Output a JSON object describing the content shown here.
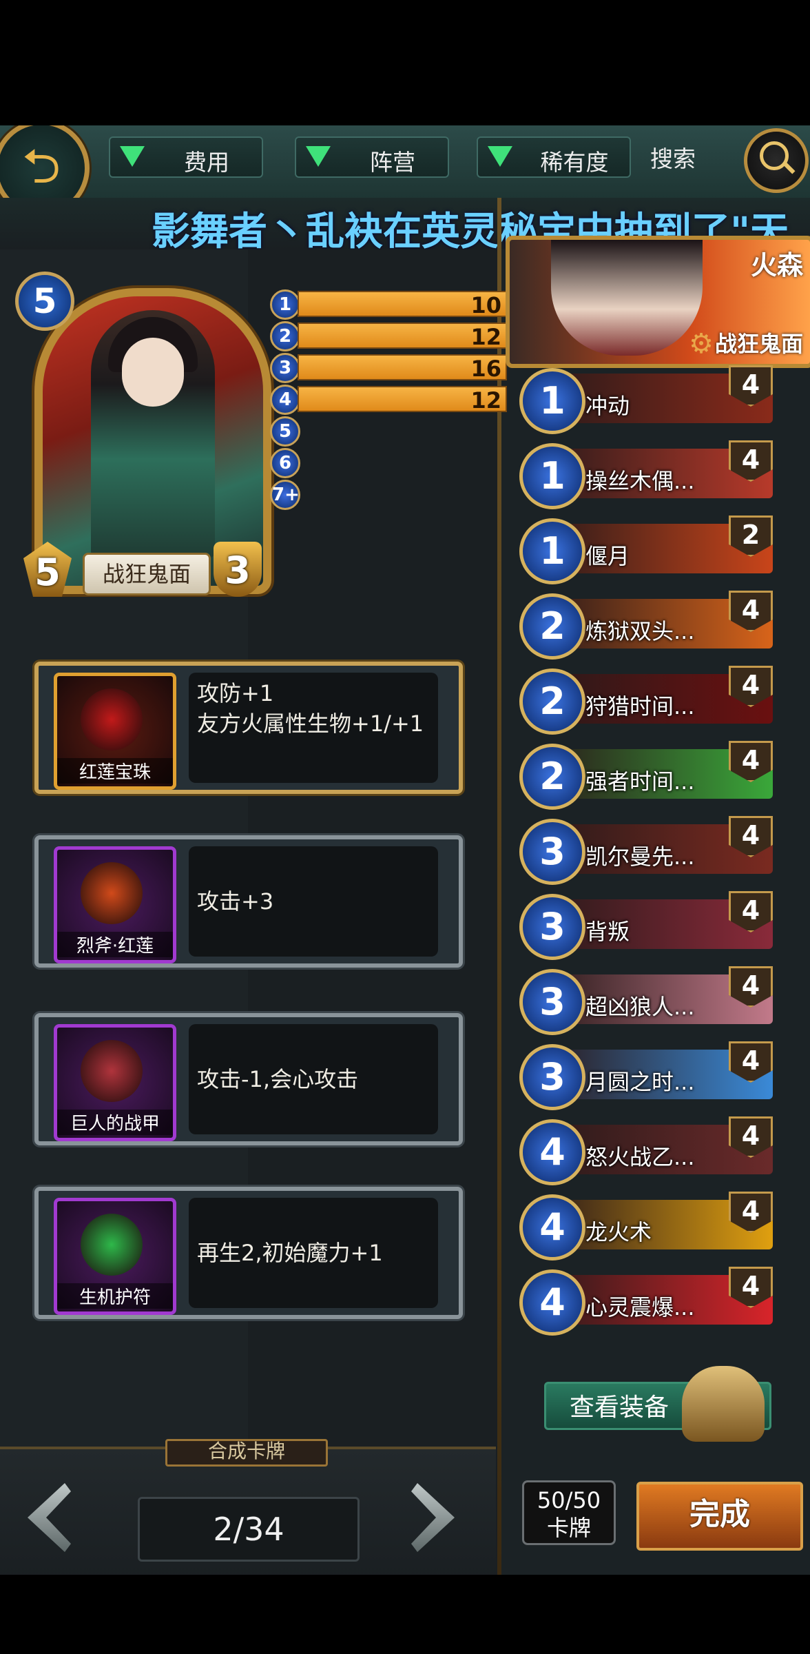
{
  "topbar": {
    "filters": [
      "费用",
      "阵营",
      "稀有度"
    ],
    "search_label": "搜索"
  },
  "marquee": "影舞者丶乱袂在英灵秘宝中抽到了\"天",
  "card": {
    "cost": "5",
    "name": "战狂鬼面",
    "attack": "5",
    "health": "3"
  },
  "curve": [
    {
      "cost": "1",
      "count": 10
    },
    {
      "cost": "2",
      "count": 12
    },
    {
      "cost": "3",
      "count": 16
    },
    {
      "cost": "4",
      "count": 12
    },
    {
      "cost": "5",
      "count": 0
    },
    {
      "cost": "6",
      "count": 0
    },
    {
      "cost": "7+",
      "count": 0
    }
  ],
  "equipment": [
    {
      "name": "红莲宝珠",
      "effect": "攻防+1\n友方火属性生物+1/+1",
      "rarity": "gold",
      "color": "#c21a1a"
    },
    {
      "name": "烈斧·红莲",
      "effect": "攻击+3",
      "rarity": "purple",
      "color": "#d14a1a"
    },
    {
      "name": "巨人的战甲",
      "effect": "攻击-1,会心攻击",
      "rarity": "purple",
      "color": "#b0343c"
    },
    {
      "name": "生机护符",
      "effect": "再生2,初始魔力+1",
      "rarity": "purple",
      "color": "#2eb84a"
    }
  ],
  "hero": {
    "faction": "火森",
    "title": "战狂鬼面"
  },
  "deck": [
    {
      "cost": "1",
      "name": "冲动",
      "count": "4",
      "color": "#8a2a1a"
    },
    {
      "cost": "1",
      "name": "操丝木偶...",
      "count": "4",
      "color": "#b83a2a"
    },
    {
      "cost": "1",
      "name": "偃月",
      "count": "2",
      "color": "#c9451a"
    },
    {
      "cost": "2",
      "name": "炼狱双头...",
      "count": "4",
      "color": "#d8641a"
    },
    {
      "cost": "2",
      "name": "狩猎时间...",
      "count": "4",
      "color": "#6a1010"
    },
    {
      "cost": "2",
      "name": "强者时间...",
      "count": "4",
      "color": "#3aa83a"
    },
    {
      "cost": "3",
      "name": "凯尔曼先...",
      "count": "4",
      "color": "#7a2a20"
    },
    {
      "cost": "3",
      "name": "背叛",
      "count": "4",
      "color": "#8a2a3a"
    },
    {
      "cost": "3",
      "name": "超凶狼人...",
      "count": "4",
      "color": "#c27a8a"
    },
    {
      "cost": "3",
      "name": "月圆之时...",
      "count": "4",
      "color": "#3a8ad8"
    },
    {
      "cost": "4",
      "name": "怒火战乙...",
      "count": "4",
      "color": "#6a2a2a"
    },
    {
      "cost": "4",
      "name": "龙火术",
      "count": "4",
      "color": "#e0a010"
    },
    {
      "cost": "4",
      "name": "心灵震爆...",
      "count": "4",
      "color": "#d8242a"
    }
  ],
  "view_gear": "查看装备",
  "synth": "合成卡牌",
  "pager": "2/34",
  "deck_count": {
    "value": "50/50",
    "label": "卡牌"
  },
  "done": "完成"
}
